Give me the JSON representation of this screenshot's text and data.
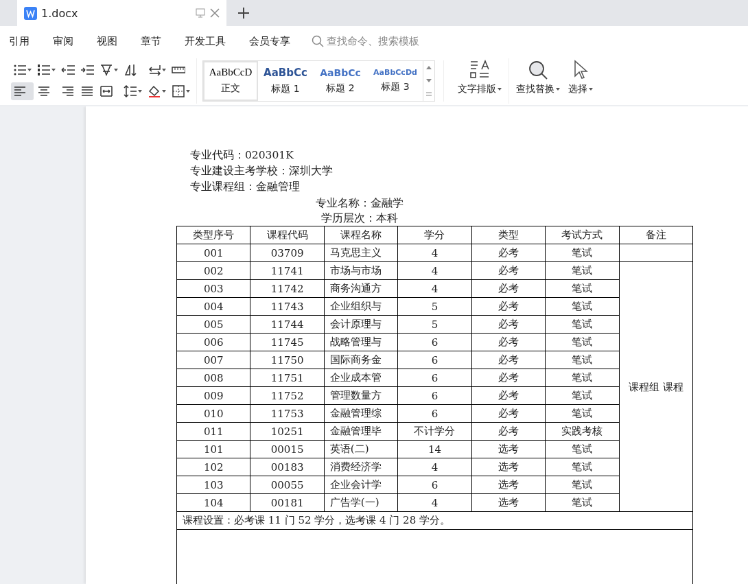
{
  "tab": {
    "title": "1.docx",
    "selected": true
  },
  "menu": [
    {
      "label": "引用"
    },
    {
      "label": "审阅"
    },
    {
      "label": "视图"
    },
    {
      "label": "章节"
    },
    {
      "label": "开发工具"
    },
    {
      "label": "会员专享"
    }
  ],
  "search": {
    "placeholder": "查找命令、搜索模板"
  },
  "paragraph_tools": [
    {
      "kind": "bullets",
      "selected": false
    },
    {
      "kind": "numbering",
      "selected": false
    },
    {
      "kind": "outdent",
      "selected": false
    },
    {
      "kind": "indent",
      "selected": false
    },
    {
      "kind": "cjk",
      "selected": false
    },
    {
      "kind": "sort",
      "selected": false
    },
    {
      "kind": "break",
      "selected": false
    },
    {
      "kind": "ruler",
      "selected": false
    },
    {
      "kind": "align-left",
      "selected": true
    },
    {
      "kind": "align-center",
      "selected": false
    },
    {
      "kind": "align-right",
      "selected": false
    },
    {
      "kind": "justify",
      "selected": false
    },
    {
      "kind": "distribute",
      "selected": false
    },
    {
      "kind": "spacing",
      "selected": false
    },
    {
      "kind": "shading",
      "selected": false
    },
    {
      "kind": "borders",
      "selected": false
    }
  ],
  "styles": [
    {
      "kind": "body",
      "sample": "AaBbCcD",
      "label": "正文",
      "selected": true
    },
    {
      "kind": "heading1",
      "sample": "AaBbCc",
      "label": "标题 1",
      "selected": false
    },
    {
      "kind": "heading2",
      "sample": "AaBbCc",
      "label": "标题 2",
      "selected": false
    },
    {
      "kind": "heading3",
      "sample": "AaBbCcDd",
      "label": "标题 3",
      "selected": false
    }
  ],
  "tools": [
    {
      "kind": "text-layout",
      "label": "文字排版"
    },
    {
      "kind": "find",
      "label": "查找替换"
    },
    {
      "kind": "select",
      "label": "选择"
    }
  ],
  "document": {
    "info": [
      "专业代码：020301K",
      "专业建设主考学校：深圳大学",
      "专业课程组：金融管理"
    ],
    "titles": [
      "专业名称：金融学",
      "学历层次：本科"
    ],
    "columns": [
      "类型序号",
      "课程代码",
      "课程名称",
      "学分",
      "类型",
      "考试方式",
      "备注"
    ],
    "rows": [
      [
        "001",
        "03709",
        "马克思主义",
        "4",
        "必考",
        "笔试"
      ],
      [
        "002",
        "11741",
        "市场与市场",
        "4",
        "必考",
        "笔试"
      ],
      [
        "003",
        "11742",
        "商务沟通方",
        "4",
        "必考",
        "笔试"
      ],
      [
        "004",
        "11743",
        "企业组织与",
        "5",
        "必考",
        "笔试"
      ],
      [
        "005",
        "11744",
        "会计原理与",
        "5",
        "必考",
        "笔试"
      ],
      [
        "006",
        "11745",
        "战略管理与",
        "6",
        "必考",
        "笔试"
      ],
      [
        "007",
        "11750",
        "国际商务金",
        "6",
        "必考",
        "笔试"
      ],
      [
        "008",
        "11751",
        "企业成本管",
        "6",
        "必考",
        "笔试"
      ],
      [
        "009",
        "11752",
        "管理数量方",
        "6",
        "必考",
        "笔试"
      ],
      [
        "010",
        "11753",
        "金融管理综",
        "6",
        "必考",
        "笔试"
      ],
      [
        "011",
        "10251",
        "金融管理毕",
        "不计学分",
        "必考",
        "实践考核"
      ],
      [
        "101",
        "00015",
        "英语(二)",
        "14",
        "选考",
        "笔试"
      ],
      [
        "102",
        "00183",
        "消费经济学",
        "4",
        "选考",
        "笔试"
      ],
      [
        "103",
        "00055",
        "企业会计学",
        "6",
        "选考",
        "笔试"
      ],
      [
        "104",
        "00181",
        "广告学(一)",
        "4",
        "选考",
        "笔试"
      ]
    ],
    "remarks": "课程组 课程",
    "summary": "课程设置：必考课 11 门 52 学分，选考课 4 门 28 学分。"
  }
}
